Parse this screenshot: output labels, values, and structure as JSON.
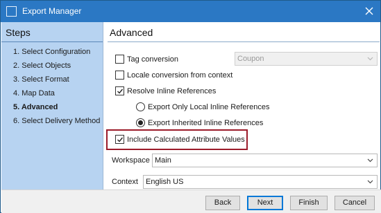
{
  "window": {
    "title": "Export Manager"
  },
  "steps": {
    "heading": "Steps",
    "items": [
      {
        "label": "1. Select Configuration",
        "active": false
      },
      {
        "label": "2. Select Objects",
        "active": false
      },
      {
        "label": "3. Select Format",
        "active": false
      },
      {
        "label": "4. Map Data",
        "active": false
      },
      {
        "label": "5. Advanced",
        "active": true
      },
      {
        "label": "6. Select Delivery Method",
        "active": false
      }
    ]
  },
  "advanced": {
    "heading": "Advanced",
    "tag_conversion": {
      "label": "Tag conversion",
      "checked": false
    },
    "tag_conversion_select": {
      "value": "Coupon",
      "disabled": true
    },
    "locale_conversion": {
      "label": "Locale conversion from context",
      "checked": false
    },
    "resolve_inline": {
      "label": "Resolve Inline References",
      "checked": true
    },
    "radio_local": {
      "label": "Export Only Local Inline References",
      "selected": false
    },
    "radio_inherited": {
      "label": "Export Inherited Inline References",
      "selected": true
    },
    "include_calculated": {
      "label": "Include Calculated Attribute Values",
      "checked": true,
      "highlighted": true
    },
    "workspace": {
      "label": "Workspace",
      "value": "Main"
    },
    "context": {
      "label": "Context",
      "value": "English US"
    }
  },
  "footer": {
    "back": "Back",
    "next": "Next",
    "finish": "Finish",
    "cancel": "Cancel"
  },
  "colors": {
    "titlebar": "#2b78c4",
    "steps_panel": "#b7d3f1",
    "highlight_border": "#9b1b2a",
    "primary_button_border": "#0078d7"
  }
}
